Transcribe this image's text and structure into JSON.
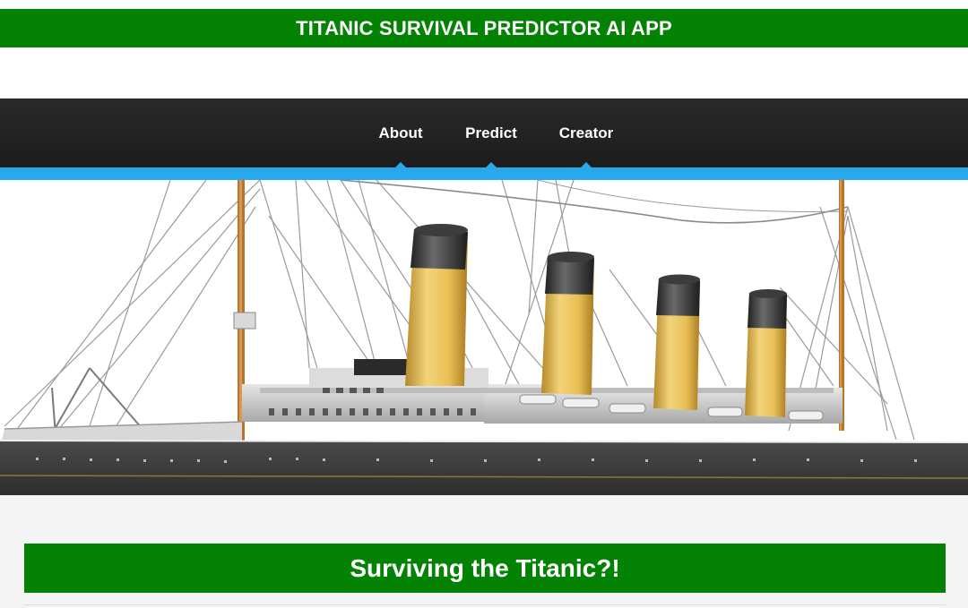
{
  "app_title": "TITANIC SURVIVAL PREDICTOR AI APP",
  "nav": {
    "items": [
      {
        "label": "About"
      },
      {
        "label": "Predict"
      },
      {
        "label": "Creator"
      }
    ]
  },
  "hero": {
    "image_subject": "ocean-liner-illustration"
  },
  "section": {
    "heading": "Surviving the Titanic?!"
  },
  "colors": {
    "banner_green": "#038203",
    "nav_dark": "#222222",
    "accent_blue": "#29a8ec",
    "funnel_yellow": "#e9c15a",
    "funnel_black": "#333333"
  }
}
